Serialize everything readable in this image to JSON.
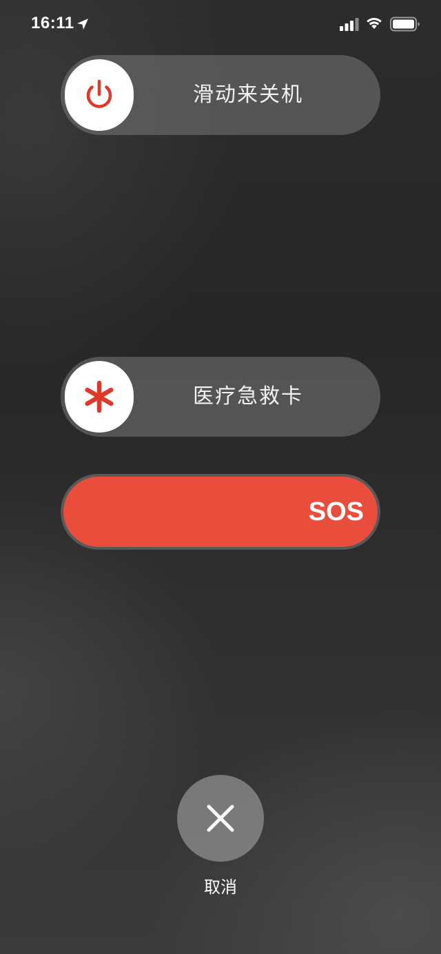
{
  "status_bar": {
    "time": "16:11",
    "icons": [
      "location-arrow-icon",
      "cellular-signal-icon",
      "wifi-icon",
      "battery-icon"
    ]
  },
  "power_slider": {
    "label": "滑动来关机",
    "icon": "power-icon",
    "icon_color": "#e0392b"
  },
  "medical_slider": {
    "label": "医疗急救卡",
    "icon": "asterisk-icon",
    "icon_color": "#e0392b"
  },
  "sos_slider": {
    "label": "SOS",
    "color": "#e94e3d"
  },
  "cancel": {
    "label": "取消",
    "icon": "close-icon"
  }
}
